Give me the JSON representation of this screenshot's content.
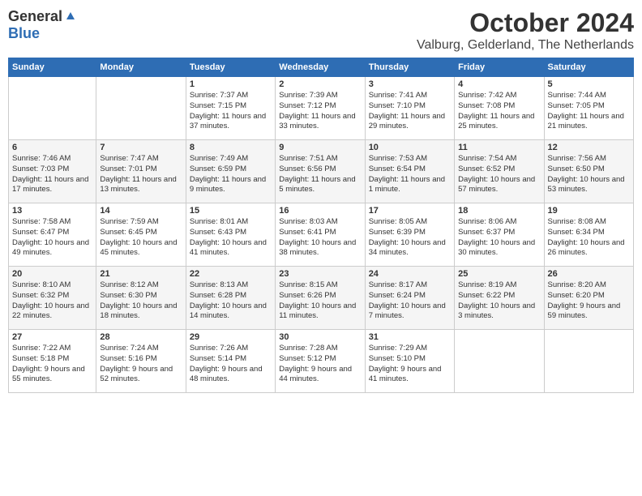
{
  "header": {
    "logo_general": "General",
    "logo_blue": "Blue",
    "month": "October 2024",
    "location": "Valburg, Gelderland, The Netherlands"
  },
  "columns": [
    "Sunday",
    "Monday",
    "Tuesday",
    "Wednesday",
    "Thursday",
    "Friday",
    "Saturday"
  ],
  "weeks": [
    [
      {
        "day": "",
        "info": ""
      },
      {
        "day": "",
        "info": ""
      },
      {
        "day": "1",
        "info": "Sunrise: 7:37 AM\nSunset: 7:15 PM\nDaylight: 11 hours and 37 minutes."
      },
      {
        "day": "2",
        "info": "Sunrise: 7:39 AM\nSunset: 7:12 PM\nDaylight: 11 hours and 33 minutes."
      },
      {
        "day": "3",
        "info": "Sunrise: 7:41 AM\nSunset: 7:10 PM\nDaylight: 11 hours and 29 minutes."
      },
      {
        "day": "4",
        "info": "Sunrise: 7:42 AM\nSunset: 7:08 PM\nDaylight: 11 hours and 25 minutes."
      },
      {
        "day": "5",
        "info": "Sunrise: 7:44 AM\nSunset: 7:05 PM\nDaylight: 11 hours and 21 minutes."
      }
    ],
    [
      {
        "day": "6",
        "info": "Sunrise: 7:46 AM\nSunset: 7:03 PM\nDaylight: 11 hours and 17 minutes."
      },
      {
        "day": "7",
        "info": "Sunrise: 7:47 AM\nSunset: 7:01 PM\nDaylight: 11 hours and 13 minutes."
      },
      {
        "day": "8",
        "info": "Sunrise: 7:49 AM\nSunset: 6:59 PM\nDaylight: 11 hours and 9 minutes."
      },
      {
        "day": "9",
        "info": "Sunrise: 7:51 AM\nSunset: 6:56 PM\nDaylight: 11 hours and 5 minutes."
      },
      {
        "day": "10",
        "info": "Sunrise: 7:53 AM\nSunset: 6:54 PM\nDaylight: 11 hours and 1 minute."
      },
      {
        "day": "11",
        "info": "Sunrise: 7:54 AM\nSunset: 6:52 PM\nDaylight: 10 hours and 57 minutes."
      },
      {
        "day": "12",
        "info": "Sunrise: 7:56 AM\nSunset: 6:50 PM\nDaylight: 10 hours and 53 minutes."
      }
    ],
    [
      {
        "day": "13",
        "info": "Sunrise: 7:58 AM\nSunset: 6:47 PM\nDaylight: 10 hours and 49 minutes."
      },
      {
        "day": "14",
        "info": "Sunrise: 7:59 AM\nSunset: 6:45 PM\nDaylight: 10 hours and 45 minutes."
      },
      {
        "day": "15",
        "info": "Sunrise: 8:01 AM\nSunset: 6:43 PM\nDaylight: 10 hours and 41 minutes."
      },
      {
        "day": "16",
        "info": "Sunrise: 8:03 AM\nSunset: 6:41 PM\nDaylight: 10 hours and 38 minutes."
      },
      {
        "day": "17",
        "info": "Sunrise: 8:05 AM\nSunset: 6:39 PM\nDaylight: 10 hours and 34 minutes."
      },
      {
        "day": "18",
        "info": "Sunrise: 8:06 AM\nSunset: 6:37 PM\nDaylight: 10 hours and 30 minutes."
      },
      {
        "day": "19",
        "info": "Sunrise: 8:08 AM\nSunset: 6:34 PM\nDaylight: 10 hours and 26 minutes."
      }
    ],
    [
      {
        "day": "20",
        "info": "Sunrise: 8:10 AM\nSunset: 6:32 PM\nDaylight: 10 hours and 22 minutes."
      },
      {
        "day": "21",
        "info": "Sunrise: 8:12 AM\nSunset: 6:30 PM\nDaylight: 10 hours and 18 minutes."
      },
      {
        "day": "22",
        "info": "Sunrise: 8:13 AM\nSunset: 6:28 PM\nDaylight: 10 hours and 14 minutes."
      },
      {
        "day": "23",
        "info": "Sunrise: 8:15 AM\nSunset: 6:26 PM\nDaylight: 10 hours and 11 minutes."
      },
      {
        "day": "24",
        "info": "Sunrise: 8:17 AM\nSunset: 6:24 PM\nDaylight: 10 hours and 7 minutes."
      },
      {
        "day": "25",
        "info": "Sunrise: 8:19 AM\nSunset: 6:22 PM\nDaylight: 10 hours and 3 minutes."
      },
      {
        "day": "26",
        "info": "Sunrise: 8:20 AM\nSunset: 6:20 PM\nDaylight: 9 hours and 59 minutes."
      }
    ],
    [
      {
        "day": "27",
        "info": "Sunrise: 7:22 AM\nSunset: 5:18 PM\nDaylight: 9 hours and 55 minutes."
      },
      {
        "day": "28",
        "info": "Sunrise: 7:24 AM\nSunset: 5:16 PM\nDaylight: 9 hours and 52 minutes."
      },
      {
        "day": "29",
        "info": "Sunrise: 7:26 AM\nSunset: 5:14 PM\nDaylight: 9 hours and 48 minutes."
      },
      {
        "day": "30",
        "info": "Sunrise: 7:28 AM\nSunset: 5:12 PM\nDaylight: 9 hours and 44 minutes."
      },
      {
        "day": "31",
        "info": "Sunrise: 7:29 AM\nSunset: 5:10 PM\nDaylight: 9 hours and 41 minutes."
      },
      {
        "day": "",
        "info": ""
      },
      {
        "day": "",
        "info": ""
      }
    ]
  ]
}
